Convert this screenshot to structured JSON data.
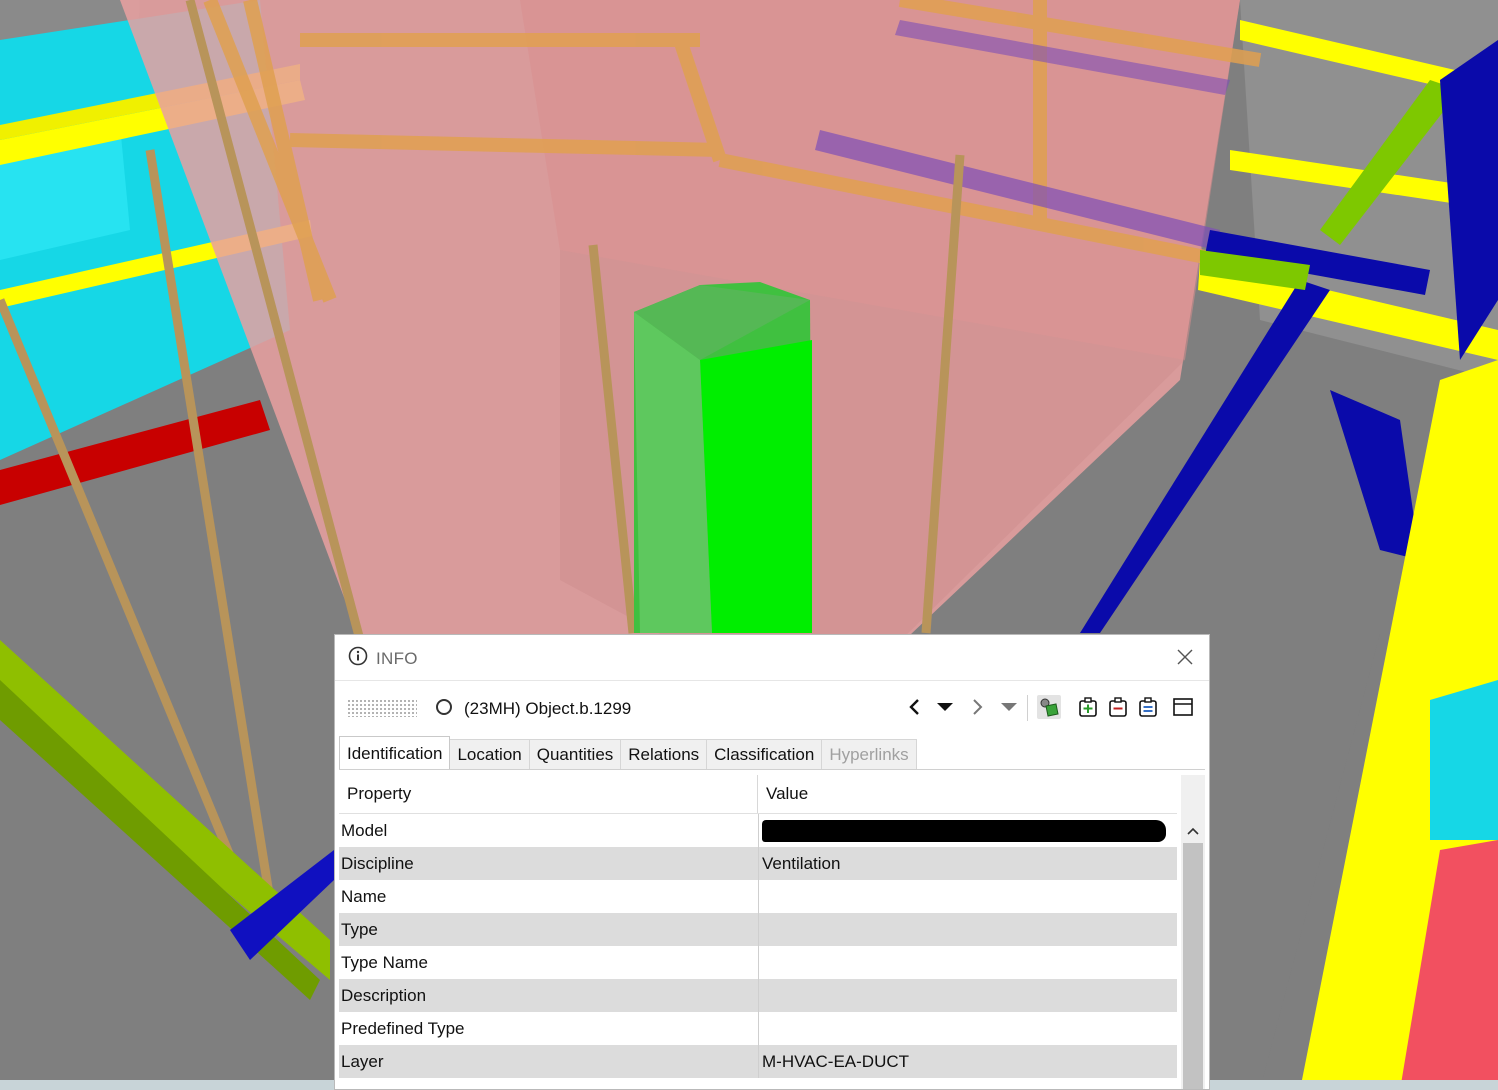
{
  "panel": {
    "title": "INFO",
    "object_name": "(23MH) Object.b.1299",
    "colors": {
      "accent_green": "#3aa33a",
      "alt_row": "#dcdcdc"
    },
    "toolbar_icons": [
      "chevron-left-icon",
      "caret-down-icon",
      "chevron-right-icon",
      "caret-down-icon",
      "color-object-icon",
      "add-group-icon",
      "remove-group-icon",
      "list-group-icon",
      "window-icon"
    ]
  },
  "tabs": [
    {
      "label": "Identification",
      "state": "selected"
    },
    {
      "label": "Location",
      "state": "normal"
    },
    {
      "label": "Quantities",
      "state": "normal"
    },
    {
      "label": "Relations",
      "state": "normal"
    },
    {
      "label": "Classification",
      "state": "normal"
    },
    {
      "label": "Hyperlinks",
      "state": "disabled"
    }
  ],
  "grid": {
    "headers": {
      "property": "Property",
      "value": "Value"
    },
    "rows": [
      {
        "property": "Model",
        "value": ""
      },
      {
        "property": "Discipline",
        "value": "Ventilation"
      },
      {
        "property": "Name",
        "value": ""
      },
      {
        "property": "Type",
        "value": ""
      },
      {
        "property": "Type Name",
        "value": ""
      },
      {
        "property": "Description",
        "value": ""
      },
      {
        "property": "Predefined Type",
        "value": ""
      },
      {
        "property": "Layer",
        "value": "M-HVAC-EA-DUCT"
      }
    ]
  }
}
